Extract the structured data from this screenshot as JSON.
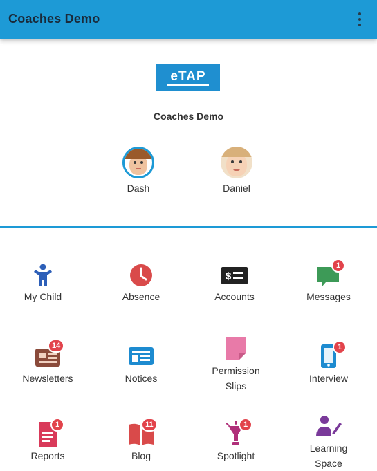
{
  "appbar": {
    "title": "Coaches Demo",
    "menu_icon": "more-vert-icon"
  },
  "logo": {
    "text": "eTAP",
    "color": "#1f8fd0"
  },
  "school_name": "Coaches Demo",
  "children": [
    {
      "name": "Dash",
      "selected": true
    },
    {
      "name": "Daniel",
      "selected": false
    }
  ],
  "tiles": [
    {
      "label": "My Child",
      "icon": "child-icon",
      "color": "#2d5fb8",
      "badge": ""
    },
    {
      "label": "Absence",
      "icon": "clock-icon",
      "color": "#d94a4a",
      "badge": ""
    },
    {
      "label": "Accounts",
      "icon": "payment-icon",
      "color": "#222222",
      "badge": ""
    },
    {
      "label": "Messages",
      "icon": "chat-icon",
      "color": "#3d9a57",
      "badge": "1"
    },
    {
      "label": "Newsletters",
      "icon": "newspaper-icon",
      "color": "#8a4a3a",
      "badge": "14"
    },
    {
      "label": "Notices",
      "icon": "notice-board-icon",
      "color": "#1d8bd0",
      "badge": ""
    },
    {
      "label": "Permission Slips",
      "icon": "slip-icon",
      "color": "#e0689a",
      "badge": ""
    },
    {
      "label": "Interview",
      "icon": "phone-icon",
      "color": "#1d8bd0",
      "badge": "1"
    },
    {
      "label": "Reports",
      "icon": "report-icon",
      "color": "#d93a5a",
      "badge": "1"
    },
    {
      "label": "Blog",
      "icon": "book-icon",
      "color": "#d94a4a",
      "badge": "11"
    },
    {
      "label": "Spotlight",
      "icon": "spotlight-icon",
      "color": "#b0307a",
      "badge": "1"
    },
    {
      "label": "Learning Space",
      "icon": "teacher-icon",
      "color": "#7a3a9a",
      "badge": ""
    }
  ],
  "colors": {
    "primary": "#1d9ad6",
    "badge": "#e2434b"
  }
}
